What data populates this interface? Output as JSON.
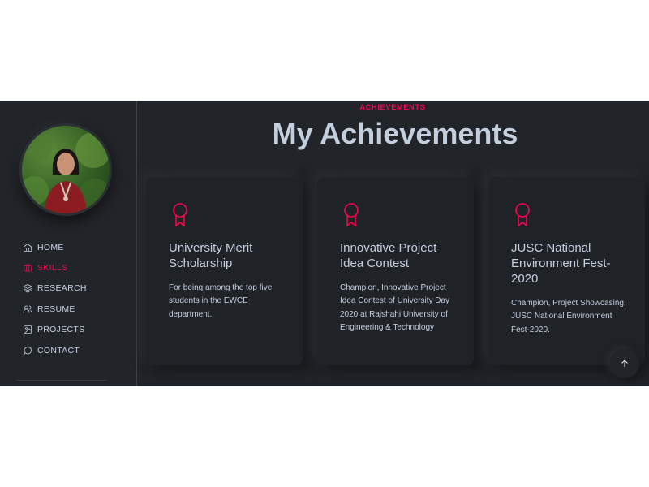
{
  "nav": {
    "items": [
      {
        "label": "HOME",
        "icon": "home-icon"
      },
      {
        "label": "SKILLS",
        "icon": "briefcase-icon",
        "active": true
      },
      {
        "label": "RESEARCH",
        "icon": "layers-icon"
      },
      {
        "label": "RESUME",
        "icon": "users-icon"
      },
      {
        "label": "PROJECTS",
        "icon": "image-icon"
      },
      {
        "label": "CONTACT",
        "icon": "message-circle-icon"
      }
    ]
  },
  "section": {
    "eyebrow": "ACHIEVEMENTS",
    "title": "My Achievements"
  },
  "cards": [
    {
      "title": "University Merit Scholarship",
      "icon": "award-icon",
      "description": "For being among the top five students in the EWCE department."
    },
    {
      "title": "Innovative Project Idea Contest",
      "icon": "award-icon",
      "description": "Champion, Innovative Project Idea Contest of University Day 2020 at Rajshahi University of Engineering & Technology"
    },
    {
      "title": "JUSC National Environment Fest-2020",
      "icon": "award-icon",
      "description": "Champion, Project Showcasing, JUSC National Environment Fest-2020."
    }
  ],
  "colors": {
    "background": "#212428",
    "accent": "#ff014f",
    "text": "#c4cfde"
  },
  "back_to_top_icon": "arrow-up-icon"
}
